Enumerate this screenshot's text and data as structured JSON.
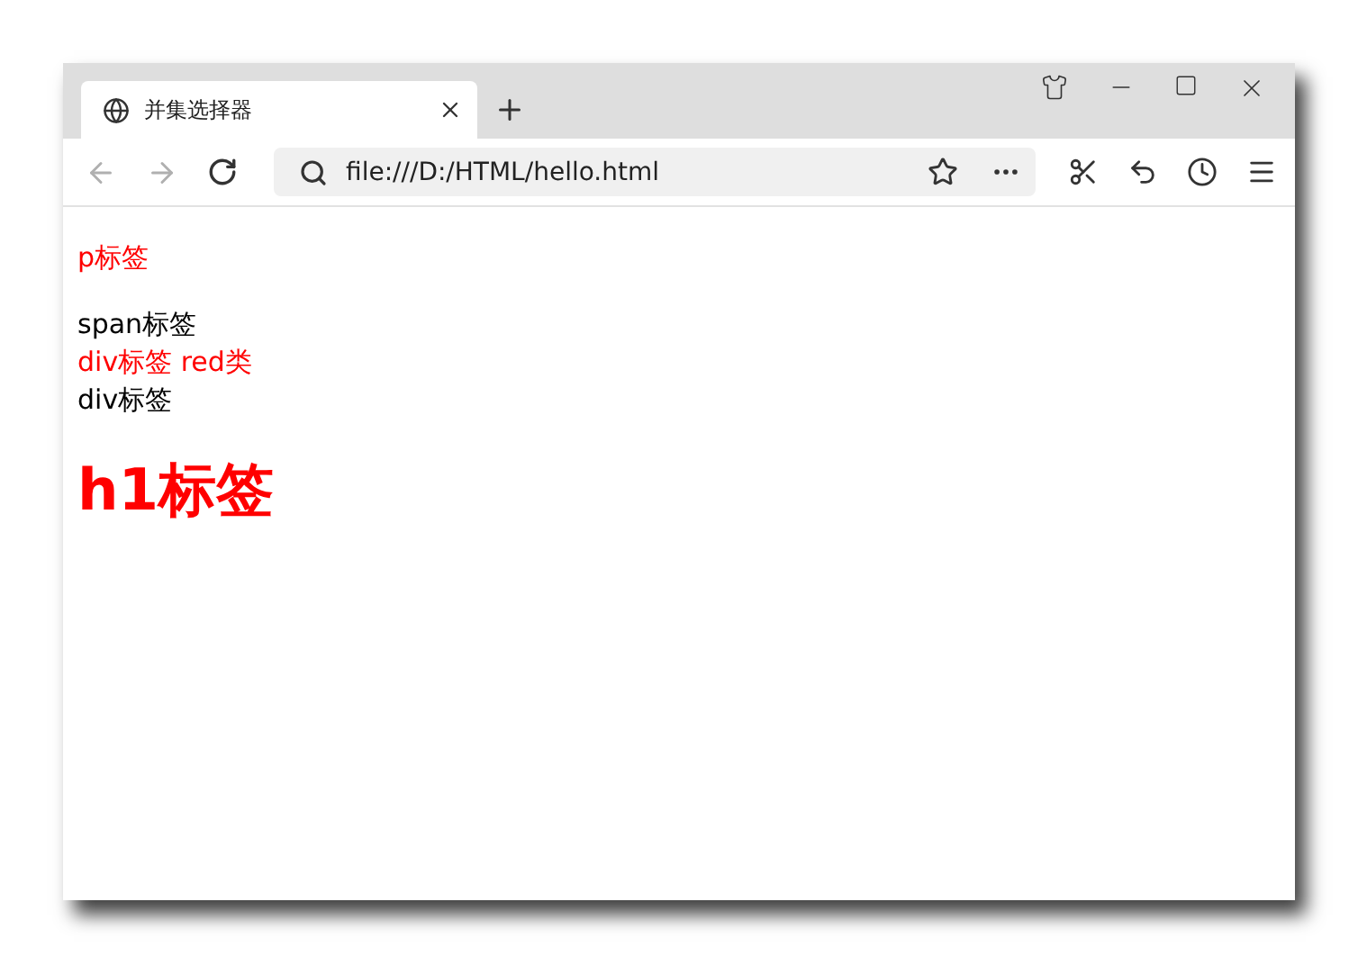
{
  "tab": {
    "title": "并集选择器",
    "selected": true
  },
  "nav": {
    "back_disabled": true,
    "forward_disabled": true
  },
  "address": {
    "value": "file:///D:/HTML/hello.html"
  },
  "content": [
    {
      "kind": "p",
      "text": "p标签",
      "color": "#ff0000"
    },
    {
      "kind": "span",
      "text": "span标签",
      "color": "#000000"
    },
    {
      "kind": "div",
      "text": "div标签 red类",
      "color": "#ff0000"
    },
    {
      "kind": "div",
      "text": "div标签",
      "color": "#000000"
    },
    {
      "kind": "h1",
      "text": "h1标签",
      "color": "#ff0000"
    }
  ]
}
